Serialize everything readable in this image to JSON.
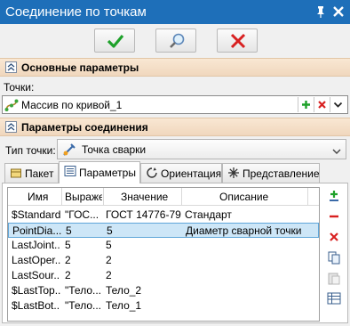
{
  "window": {
    "title": "Соединение по точкам"
  },
  "sections": {
    "main": "Основные параметры",
    "connection": "Параметры соединения"
  },
  "points": {
    "label": "Точки:",
    "value": "Массив по кривой_1"
  },
  "point_type": {
    "label": "Тип точки:",
    "value": "Точка сварки"
  },
  "tabs": [
    {
      "label": "Пакет",
      "icon": "package-icon"
    },
    {
      "label": "Параметры",
      "icon": "parameters-icon"
    },
    {
      "label": "Ориентация",
      "icon": "orientation-icon"
    },
    {
      "label": "Представление",
      "icon": "representation-icon"
    }
  ],
  "grid": {
    "headers": [
      "Имя",
      "Выражен",
      "Значение",
      "Описание"
    ],
    "rows": [
      [
        "$Standard",
        "\"ГОС...",
        "ГОСТ 14776-79",
        "Стандарт"
      ],
      [
        "PointDia...",
        "5",
        "5",
        "Диаметр сварной точки"
      ],
      [
        "LastJoint...",
        "5",
        "5",
        ""
      ],
      [
        "LastOper...",
        "2",
        "2",
        ""
      ],
      [
        "LastSour...",
        "2",
        "2",
        ""
      ],
      [
        "$LastTop...",
        "\"Тело...",
        "Тело_2",
        ""
      ],
      [
        "$LastBot...",
        "\"Тело...",
        "Тело_1",
        ""
      ]
    ],
    "selected_row": 1
  },
  "colors": {
    "titlebar": "#1e6fb9",
    "section": "#f0d7bd",
    "selection": "#cde6f7",
    "ok": "#1ea12a",
    "cancel": "#d82020"
  }
}
